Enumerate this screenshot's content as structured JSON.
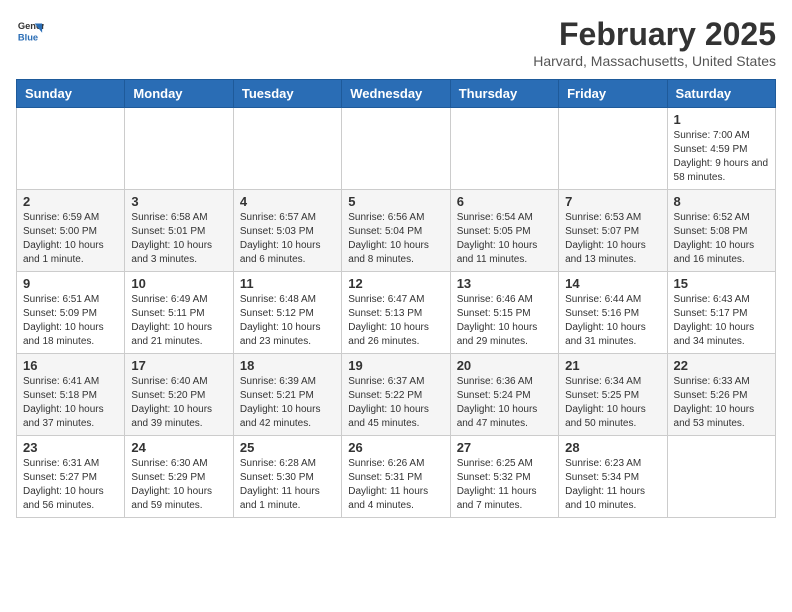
{
  "header": {
    "logo_general": "General",
    "logo_blue": "Blue",
    "month_title": "February 2025",
    "location": "Harvard, Massachusetts, United States"
  },
  "calendar": {
    "days_of_week": [
      "Sunday",
      "Monday",
      "Tuesday",
      "Wednesday",
      "Thursday",
      "Friday",
      "Saturday"
    ],
    "weeks": [
      [
        {
          "day": "",
          "info": ""
        },
        {
          "day": "",
          "info": ""
        },
        {
          "day": "",
          "info": ""
        },
        {
          "day": "",
          "info": ""
        },
        {
          "day": "",
          "info": ""
        },
        {
          "day": "",
          "info": ""
        },
        {
          "day": "1",
          "info": "Sunrise: 7:00 AM\nSunset: 4:59 PM\nDaylight: 9 hours and 58 minutes."
        }
      ],
      [
        {
          "day": "2",
          "info": "Sunrise: 6:59 AM\nSunset: 5:00 PM\nDaylight: 10 hours and 1 minute."
        },
        {
          "day": "3",
          "info": "Sunrise: 6:58 AM\nSunset: 5:01 PM\nDaylight: 10 hours and 3 minutes."
        },
        {
          "day": "4",
          "info": "Sunrise: 6:57 AM\nSunset: 5:03 PM\nDaylight: 10 hours and 6 minutes."
        },
        {
          "day": "5",
          "info": "Sunrise: 6:56 AM\nSunset: 5:04 PM\nDaylight: 10 hours and 8 minutes."
        },
        {
          "day": "6",
          "info": "Sunrise: 6:54 AM\nSunset: 5:05 PM\nDaylight: 10 hours and 11 minutes."
        },
        {
          "day": "7",
          "info": "Sunrise: 6:53 AM\nSunset: 5:07 PM\nDaylight: 10 hours and 13 minutes."
        },
        {
          "day": "8",
          "info": "Sunrise: 6:52 AM\nSunset: 5:08 PM\nDaylight: 10 hours and 16 minutes."
        }
      ],
      [
        {
          "day": "9",
          "info": "Sunrise: 6:51 AM\nSunset: 5:09 PM\nDaylight: 10 hours and 18 minutes."
        },
        {
          "day": "10",
          "info": "Sunrise: 6:49 AM\nSunset: 5:11 PM\nDaylight: 10 hours and 21 minutes."
        },
        {
          "day": "11",
          "info": "Sunrise: 6:48 AM\nSunset: 5:12 PM\nDaylight: 10 hours and 23 minutes."
        },
        {
          "day": "12",
          "info": "Sunrise: 6:47 AM\nSunset: 5:13 PM\nDaylight: 10 hours and 26 minutes."
        },
        {
          "day": "13",
          "info": "Sunrise: 6:46 AM\nSunset: 5:15 PM\nDaylight: 10 hours and 29 minutes."
        },
        {
          "day": "14",
          "info": "Sunrise: 6:44 AM\nSunset: 5:16 PM\nDaylight: 10 hours and 31 minutes."
        },
        {
          "day": "15",
          "info": "Sunrise: 6:43 AM\nSunset: 5:17 PM\nDaylight: 10 hours and 34 minutes."
        }
      ],
      [
        {
          "day": "16",
          "info": "Sunrise: 6:41 AM\nSunset: 5:18 PM\nDaylight: 10 hours and 37 minutes."
        },
        {
          "day": "17",
          "info": "Sunrise: 6:40 AM\nSunset: 5:20 PM\nDaylight: 10 hours and 39 minutes."
        },
        {
          "day": "18",
          "info": "Sunrise: 6:39 AM\nSunset: 5:21 PM\nDaylight: 10 hours and 42 minutes."
        },
        {
          "day": "19",
          "info": "Sunrise: 6:37 AM\nSunset: 5:22 PM\nDaylight: 10 hours and 45 minutes."
        },
        {
          "day": "20",
          "info": "Sunrise: 6:36 AM\nSunset: 5:24 PM\nDaylight: 10 hours and 47 minutes."
        },
        {
          "day": "21",
          "info": "Sunrise: 6:34 AM\nSunset: 5:25 PM\nDaylight: 10 hours and 50 minutes."
        },
        {
          "day": "22",
          "info": "Sunrise: 6:33 AM\nSunset: 5:26 PM\nDaylight: 10 hours and 53 minutes."
        }
      ],
      [
        {
          "day": "23",
          "info": "Sunrise: 6:31 AM\nSunset: 5:27 PM\nDaylight: 10 hours and 56 minutes."
        },
        {
          "day": "24",
          "info": "Sunrise: 6:30 AM\nSunset: 5:29 PM\nDaylight: 10 hours and 59 minutes."
        },
        {
          "day": "25",
          "info": "Sunrise: 6:28 AM\nSunset: 5:30 PM\nDaylight: 11 hours and 1 minute."
        },
        {
          "day": "26",
          "info": "Sunrise: 6:26 AM\nSunset: 5:31 PM\nDaylight: 11 hours and 4 minutes."
        },
        {
          "day": "27",
          "info": "Sunrise: 6:25 AM\nSunset: 5:32 PM\nDaylight: 11 hours and 7 minutes."
        },
        {
          "day": "28",
          "info": "Sunrise: 6:23 AM\nSunset: 5:34 PM\nDaylight: 11 hours and 10 minutes."
        },
        {
          "day": "",
          "info": ""
        }
      ]
    ]
  }
}
